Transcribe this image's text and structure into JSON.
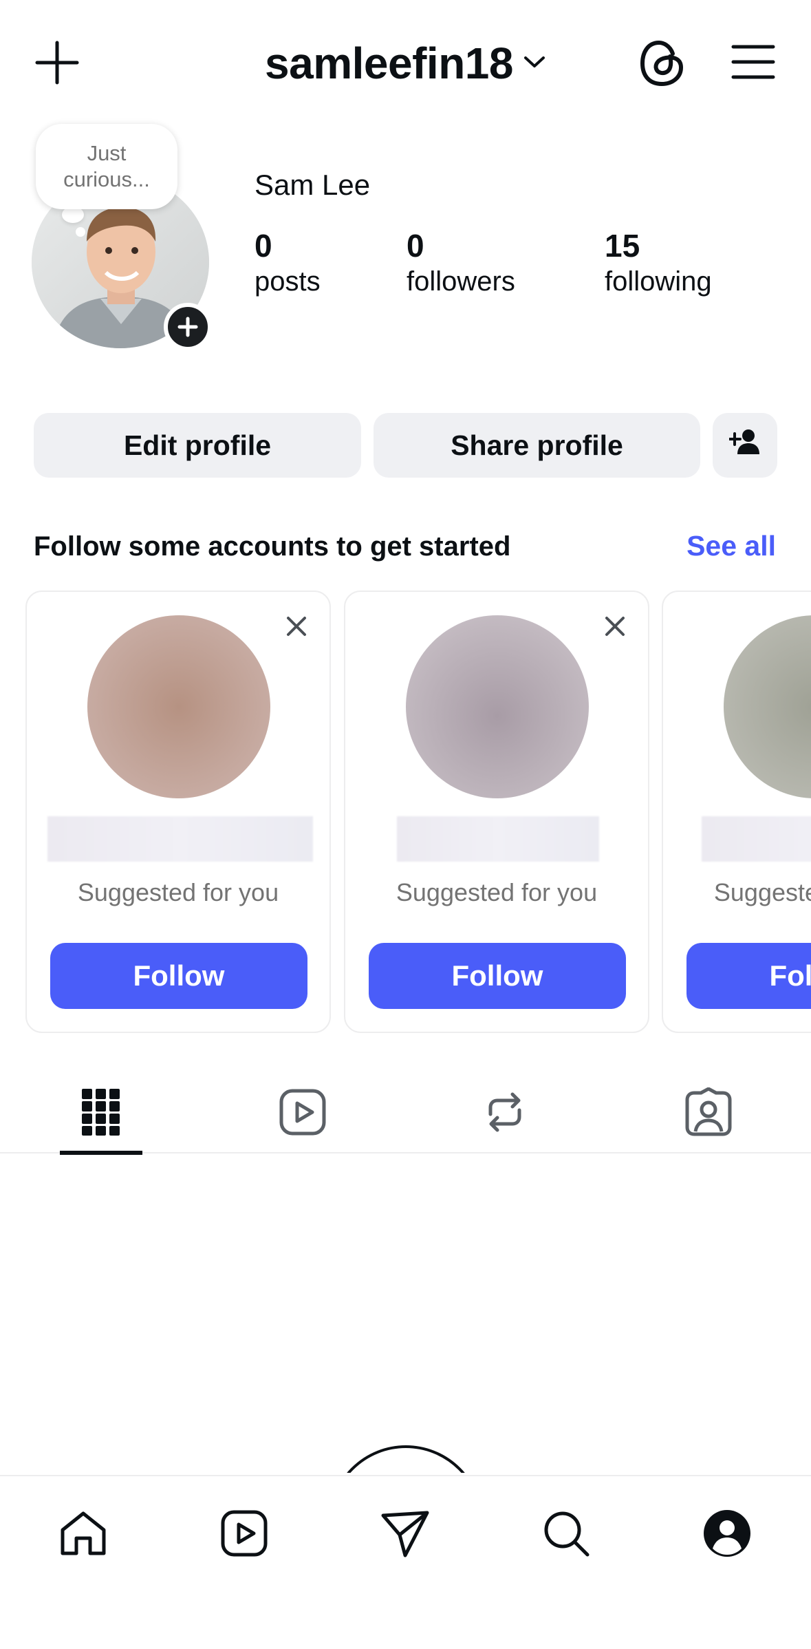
{
  "header": {
    "username": "samleefin18",
    "icons": {
      "create": "plus-icon",
      "switch": "chevron-down-icon",
      "threads": "threads-icon",
      "menu": "menu-icon"
    }
  },
  "profile": {
    "note": [
      "Just",
      "curious..."
    ],
    "full_name": "Sam Lee",
    "stats": [
      {
        "value": "0",
        "label": "posts"
      },
      {
        "value": "0",
        "label": "followers"
      },
      {
        "value": "15",
        "label": "following"
      }
    ]
  },
  "actions": {
    "edit_label": "Edit profile",
    "share_label": "Share profile"
  },
  "suggestions": {
    "title": "Follow some accounts to get started",
    "see_all_label": "See all",
    "cards": [
      {
        "subtitle": "Suggested for you",
        "follow_label": "Follow",
        "photo_color": "#b89a90"
      },
      {
        "subtitle": "Suggested for you",
        "follow_label": "Follow",
        "photo_color": "#b2a8b0"
      },
      {
        "subtitle": "Suggested for you",
        "follow_label": "Follow",
        "photo_color": "#a9aaa0"
      }
    ]
  },
  "tabs": [
    "grid-icon",
    "reels-icon",
    "reposts-icon",
    "tagged-icon"
  ],
  "bottom_nav": [
    "home-icon",
    "reels-icon",
    "messages-icon",
    "search-icon",
    "profile-icon"
  ],
  "colors": {
    "accent": "#4a5df9",
    "button_gray": "#eff0f3",
    "text": "#0c1014",
    "muted": "#737373"
  }
}
